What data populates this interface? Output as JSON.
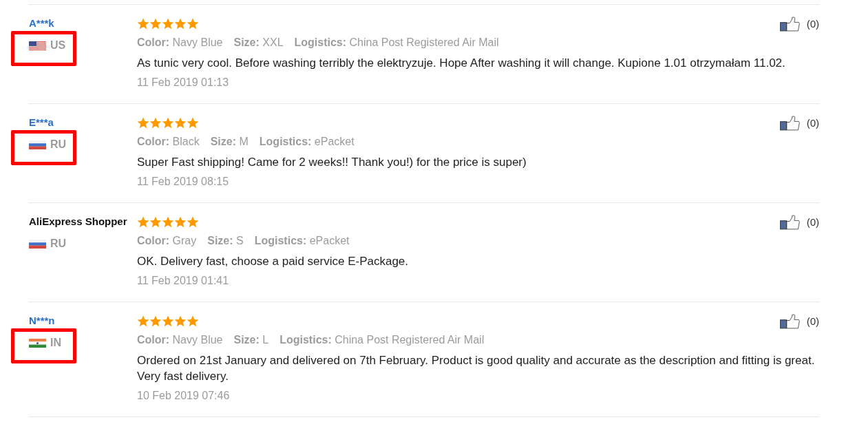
{
  "reviews": [
    {
      "name": "A***k",
      "linked": true,
      "flag": {
        "kind": "us"
      },
      "country": "US",
      "highlighted": true,
      "stars": 5,
      "attributes": [
        {
          "label": "Color:",
          "value": "Navy Blue"
        },
        {
          "label": "Size:",
          "value": "XXL"
        },
        {
          "label": "Logistics:",
          "value": "China Post Registered Air Mail"
        }
      ],
      "text": "As tunic very cool. Before washing terribly the elektryzuje. Hope After washing it will change. Kupione 1.01 otrzymałam 11.02.",
      "date": "11 Feb 2019 01:13",
      "likes": "(0)"
    },
    {
      "name": "E***a",
      "linked": true,
      "flag": {
        "kind": "ru"
      },
      "country": "RU",
      "highlighted": true,
      "stars": 5,
      "attributes": [
        {
          "label": "Color:",
          "value": "Black"
        },
        {
          "label": "Size:",
          "value": "M"
        },
        {
          "label": "Logistics:",
          "value": "ePacket"
        }
      ],
      "text": "Super Fast shipping! Came for 2 weeks!! Thank you!) for the price is super)",
      "date": "11 Feb 2019 08:15",
      "likes": "(0)"
    },
    {
      "name": "AliExpress Shopper",
      "linked": false,
      "flag": {
        "kind": "ru"
      },
      "country": "RU",
      "highlighted": false,
      "stars": 5,
      "attributes": [
        {
          "label": "Color:",
          "value": "Gray"
        },
        {
          "label": "Size:",
          "value": "S"
        },
        {
          "label": "Logistics:",
          "value": "ePacket"
        }
      ],
      "text": "OK. Delivery fast, choose a paid service E-Package.",
      "date": "11 Feb 2019 01:41",
      "likes": "(0)"
    },
    {
      "name": "N***n",
      "linked": true,
      "flag": {
        "kind": "in"
      },
      "country": "IN",
      "highlighted": true,
      "stars": 5,
      "attributes": [
        {
          "label": "Color:",
          "value": "Navy Blue"
        },
        {
          "label": "Size:",
          "value": "L"
        },
        {
          "label": "Logistics:",
          "value": "China Post Registered Air Mail"
        }
      ],
      "text": "Ordered on 21st January and delivered on 7th February. Product is good quality and accurate as the description and fitting is great. Very fast delivery.",
      "date": "10 Feb 2019 07:46",
      "likes": "(0)"
    }
  ]
}
